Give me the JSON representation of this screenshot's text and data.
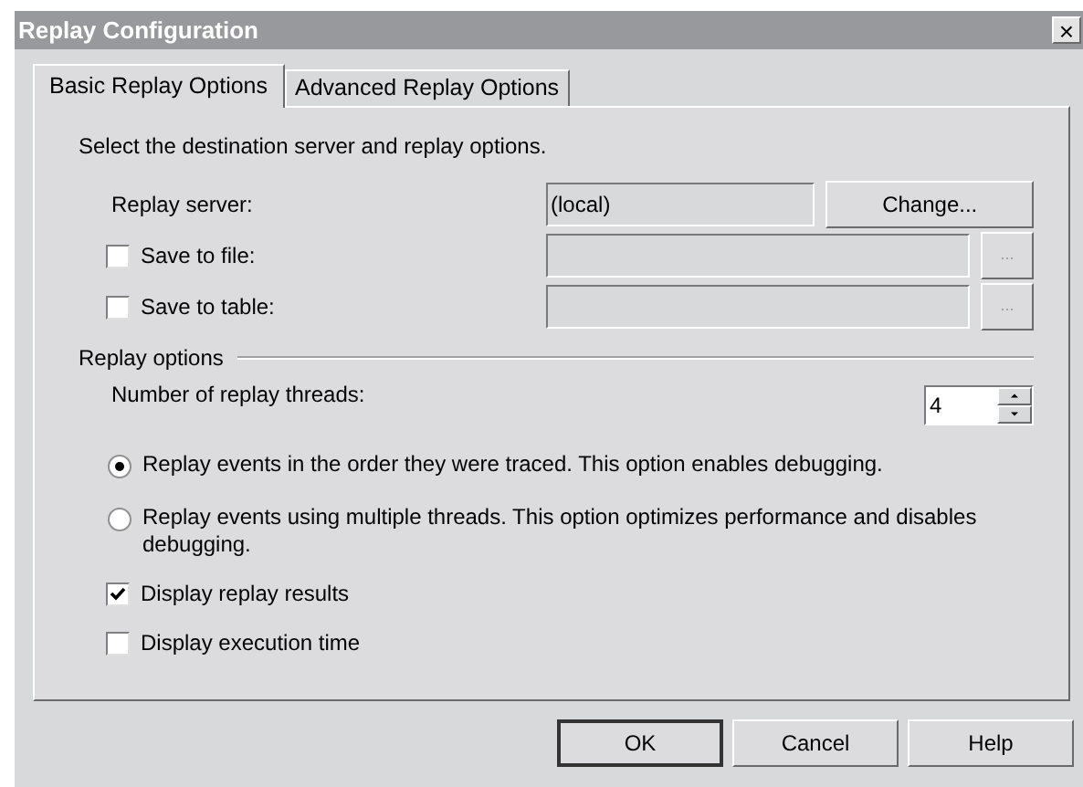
{
  "window": {
    "title": "Replay Configuration",
    "close": "×"
  },
  "tabs": [
    {
      "label": "Basic Replay Options",
      "selected": true
    },
    {
      "label": "Advanced Replay Options",
      "selected": false
    }
  ],
  "description": "Select the destination server and replay options.",
  "replay_server": {
    "label": "Replay server:",
    "value": "(local)",
    "button": "Change..."
  },
  "outputs": [
    {
      "label": "Save to file:",
      "checked": false,
      "disabled": true,
      "browse": "..."
    },
    {
      "label": "Save to table:",
      "checked": false,
      "disabled": true,
      "browse": "..."
    }
  ],
  "replay_options": {
    "title": "Replay options",
    "threads_label": "Number of replay threads:",
    "threads_value": "4"
  },
  "modes": [
    {
      "label": "Replay events in the order they were traced. This option enables debugging.",
      "selected": true
    },
    {
      "label": "Replay events using multiple threads. This option optimizes performance and disables debugging.",
      "selected": false
    }
  ],
  "display": [
    {
      "label": "Display replay results",
      "checked": true
    },
    {
      "label": "Display execution time",
      "checked": false
    }
  ],
  "buttons": [
    {
      "label": "OK",
      "default": true
    },
    {
      "label": "Cancel",
      "default": false
    },
    {
      "label": "Help",
      "default": false
    }
  ]
}
